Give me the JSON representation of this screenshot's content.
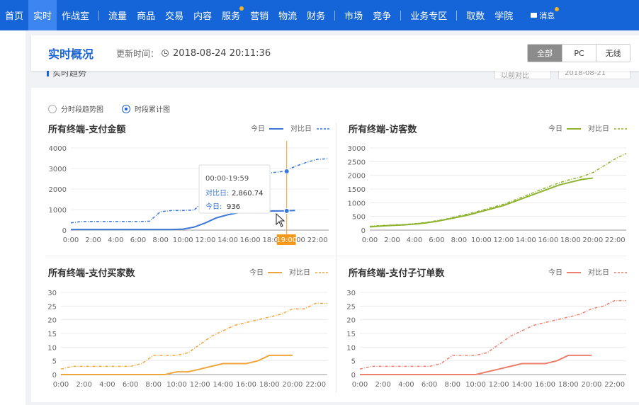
{
  "nav": {
    "items": [
      {
        "label": "首页",
        "active": false
      },
      {
        "label": "实时",
        "active": true
      },
      {
        "label": "作战室",
        "active": false
      },
      {
        "sep": true
      },
      {
        "label": "流量",
        "active": false
      },
      {
        "label": "商品",
        "active": false
      },
      {
        "label": "交易",
        "active": false
      },
      {
        "label": "内容",
        "active": false
      },
      {
        "label": "服务",
        "active": false,
        "dot": true
      },
      {
        "label": "营销",
        "active": false
      },
      {
        "label": "物流",
        "active": false
      },
      {
        "label": "财务",
        "active": false
      },
      {
        "sep": true
      },
      {
        "label": "市场",
        "active": false
      },
      {
        "label": "竞争",
        "active": false
      },
      {
        "sep": true
      },
      {
        "label": "业务专区",
        "active": false
      },
      {
        "sep": true
      },
      {
        "label": "取数",
        "active": false
      },
      {
        "label": "学院",
        "active": false
      }
    ],
    "message_label": "消息"
  },
  "header": {
    "title": "实时概况",
    "update_label": "更新时间：",
    "update_time": "2018-08-24 20:11:36",
    "segments": [
      {
        "label": "全部",
        "on": true
      },
      {
        "label": "PC",
        "on": false
      },
      {
        "label": "无线",
        "on": false
      }
    ]
  },
  "under": {
    "title": "实时趋势",
    "select1": "以前对比",
    "select2": "2018-08-21"
  },
  "radios": [
    {
      "label": "分时段趋势图",
      "checked": false
    },
    {
      "label": "时段累计图",
      "checked": true
    }
  ],
  "legend": {
    "today": "今日",
    "compare": "对比日"
  },
  "tooltip": {
    "time": "00:00-19:59",
    "compare_label": "对比日:",
    "compare_value": "2,860.74",
    "today_label": "今日:",
    "today_value": "936"
  },
  "highlight_tick": "19:00",
  "chart_data": [
    {
      "type": "line",
      "title": "所有终端-支付金额",
      "color": "#3b78d8",
      "x": [
        "00:00",
        "01:00",
        "02:00",
        "03:00",
        "04:00",
        "05:00",
        "06:00",
        "07:00",
        "08:00",
        "09:00",
        "10:00",
        "11:00",
        "12:00",
        "13:00",
        "14:00",
        "15:00",
        "16:00",
        "17:00",
        "18:00",
        "19:00",
        "20:00",
        "21:00",
        "22:00",
        "23:00"
      ],
      "xticks": [
        "0:00",
        "2:00",
        "4:00",
        "6:00",
        "8:00",
        "10:00",
        "12:00",
        "14:00",
        "16:00",
        "18:00",
        "20:00",
        "22:00"
      ],
      "yticks": [
        "0",
        "1000",
        "2000",
        "3000",
        "4000"
      ],
      "ylim": [
        0,
        4000
      ],
      "series": [
        {
          "name": "今日",
          "values": [
            30,
            30,
            30,
            30,
            30,
            30,
            30,
            30,
            30,
            30,
            50,
            150,
            350,
            600,
            750,
            850,
            900,
            920,
            930,
            936,
            960
          ]
        },
        {
          "name": "对比日",
          "values": [
            350,
            420,
            420,
            420,
            420,
            420,
            420,
            430,
            900,
            950,
            950,
            980,
            1500,
            1700,
            2000,
            2400,
            2600,
            2750,
            2800,
            2860.74,
            3100,
            3300,
            3450,
            3480
          ]
        }
      ]
    },
    {
      "type": "line",
      "title": "所有终端-访客数",
      "color": "#8fb32f",
      "x": [
        "00:00",
        "01:00",
        "02:00",
        "03:00",
        "04:00",
        "05:00",
        "06:00",
        "07:00",
        "08:00",
        "09:00",
        "10:00",
        "11:00",
        "12:00",
        "13:00",
        "14:00",
        "15:00",
        "16:00",
        "17:00",
        "18:00",
        "19:00",
        "20:00",
        "21:00",
        "22:00",
        "23:00"
      ],
      "xticks": [
        "0:00",
        "2:00",
        "4:00",
        "6:00",
        "8:00",
        "10:00",
        "12:00",
        "14:00",
        "16:00",
        "18:00",
        "20:00",
        "22:00"
      ],
      "yticks": [
        "0",
        "500",
        "1000",
        "1500",
        "2000",
        "2500",
        "3000"
      ],
      "ylim": [
        0,
        3000
      ],
      "series": [
        {
          "name": "今日",
          "values": [
            120,
            150,
            170,
            190,
            220,
            260,
            320,
            400,
            480,
            570,
            680,
            790,
            900,
            1050,
            1200,
            1350,
            1500,
            1650,
            1750,
            1850,
            1900
          ]
        },
        {
          "name": "对比日",
          "values": [
            140,
            165,
            185,
            205,
            235,
            280,
            345,
            420,
            520,
            610,
            720,
            830,
            950,
            1100,
            1260,
            1420,
            1580,
            1730,
            1850,
            1950,
            2100,
            2350,
            2600,
            2800
          ]
        }
      ]
    },
    {
      "type": "line",
      "title": "所有终端-支付买家数",
      "color": "#f0a53a",
      "x": [
        "00:00",
        "01:00",
        "02:00",
        "03:00",
        "04:00",
        "05:00",
        "06:00",
        "07:00",
        "08:00",
        "09:00",
        "10:00",
        "11:00",
        "12:00",
        "13:00",
        "14:00",
        "15:00",
        "16:00",
        "17:00",
        "18:00",
        "19:00",
        "20:00",
        "21:00",
        "22:00",
        "23:00"
      ],
      "xticks": [
        "0:00",
        "2:00",
        "4:00",
        "6:00",
        "8:00",
        "10:00",
        "12:00",
        "14:00",
        "16:00",
        "18:00",
        "20:00",
        "22:00"
      ],
      "yticks": [
        "0",
        "5",
        "10",
        "15",
        "20",
        "25",
        "30"
      ],
      "ylim": [
        0,
        30
      ],
      "series": [
        {
          "name": "今日",
          "values": [
            0,
            0,
            0,
            0,
            0,
            0,
            0,
            0,
            0,
            0,
            1,
            1,
            2,
            3,
            4,
            4,
            4,
            5,
            7,
            7,
            7
          ]
        },
        {
          "name": "对比日",
          "values": [
            2,
            3,
            3,
            3,
            3,
            3,
            3,
            4,
            7,
            7,
            7,
            8,
            11,
            14,
            16,
            18,
            19,
            20,
            21,
            22,
            24,
            24,
            26,
            26
          ]
        }
      ]
    },
    {
      "type": "line",
      "title": "所有终端-支付子订单数",
      "color": "#ec7f6c",
      "x": [
        "00:00",
        "01:00",
        "02:00",
        "03:00",
        "04:00",
        "05:00",
        "06:00",
        "07:00",
        "08:00",
        "09:00",
        "10:00",
        "11:00",
        "12:00",
        "13:00",
        "14:00",
        "15:00",
        "16:00",
        "17:00",
        "18:00",
        "19:00",
        "20:00",
        "21:00",
        "22:00",
        "23:00"
      ],
      "xticks": [
        "0:00",
        "2:00",
        "4:00",
        "6:00",
        "8:00",
        "10:00",
        "12:00",
        "14:00",
        "16:00",
        "18:00",
        "20:00",
        "22:00"
      ],
      "yticks": [
        "0",
        "5",
        "10",
        "15",
        "20",
        "25",
        "30"
      ],
      "ylim": [
        0,
        30
      ],
      "series": [
        {
          "name": "今日",
          "values": [
            0,
            0,
            0,
            0,
            0,
            0,
            0,
            0,
            0,
            0,
            0,
            1,
            2,
            3,
            4,
            4,
            4,
            5,
            7,
            7,
            7
          ]
        },
        {
          "name": "对比日",
          "values": [
            2,
            3,
            3,
            3,
            3,
            3,
            3,
            4,
            7,
            7,
            7,
            8,
            11,
            14,
            16,
            18,
            19,
            20,
            21,
            22,
            24,
            25,
            27,
            27
          ]
        }
      ]
    }
  ]
}
